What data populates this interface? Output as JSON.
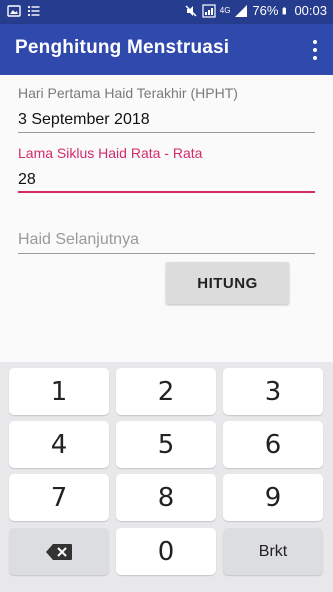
{
  "status_bar": {
    "battery_percent": "76%",
    "time": "00:03",
    "signal_label": "4G",
    "icons": [
      "gallery-icon",
      "notes-icon",
      "mute-icon",
      "wifi-icon",
      "signal-icon",
      "battery-icon"
    ]
  },
  "app_bar": {
    "title": "Penghitung Menstruasi",
    "overflow_icon": "more-vert-icon"
  },
  "form": {
    "hpht_label": "Hari Pertama Haid Terakhir (HPHT)",
    "hpht_value": "3 September 2018",
    "cycle_label": "Lama Siklus Haid Rata - Rata",
    "cycle_value": "28",
    "next_period_hint": "Haid Selanjutnya",
    "calculate_button": "HITUNG"
  },
  "keyboard": {
    "keys": [
      "1",
      "2",
      "3",
      "4",
      "5",
      "6",
      "7",
      "8",
      "9",
      "0"
    ],
    "done_key": "Brkt",
    "backspace_icon": "backspace-icon"
  },
  "colors": {
    "status_bar": "#263c8f",
    "app_bar": "#3049ad",
    "accent": "#d42a6a"
  }
}
